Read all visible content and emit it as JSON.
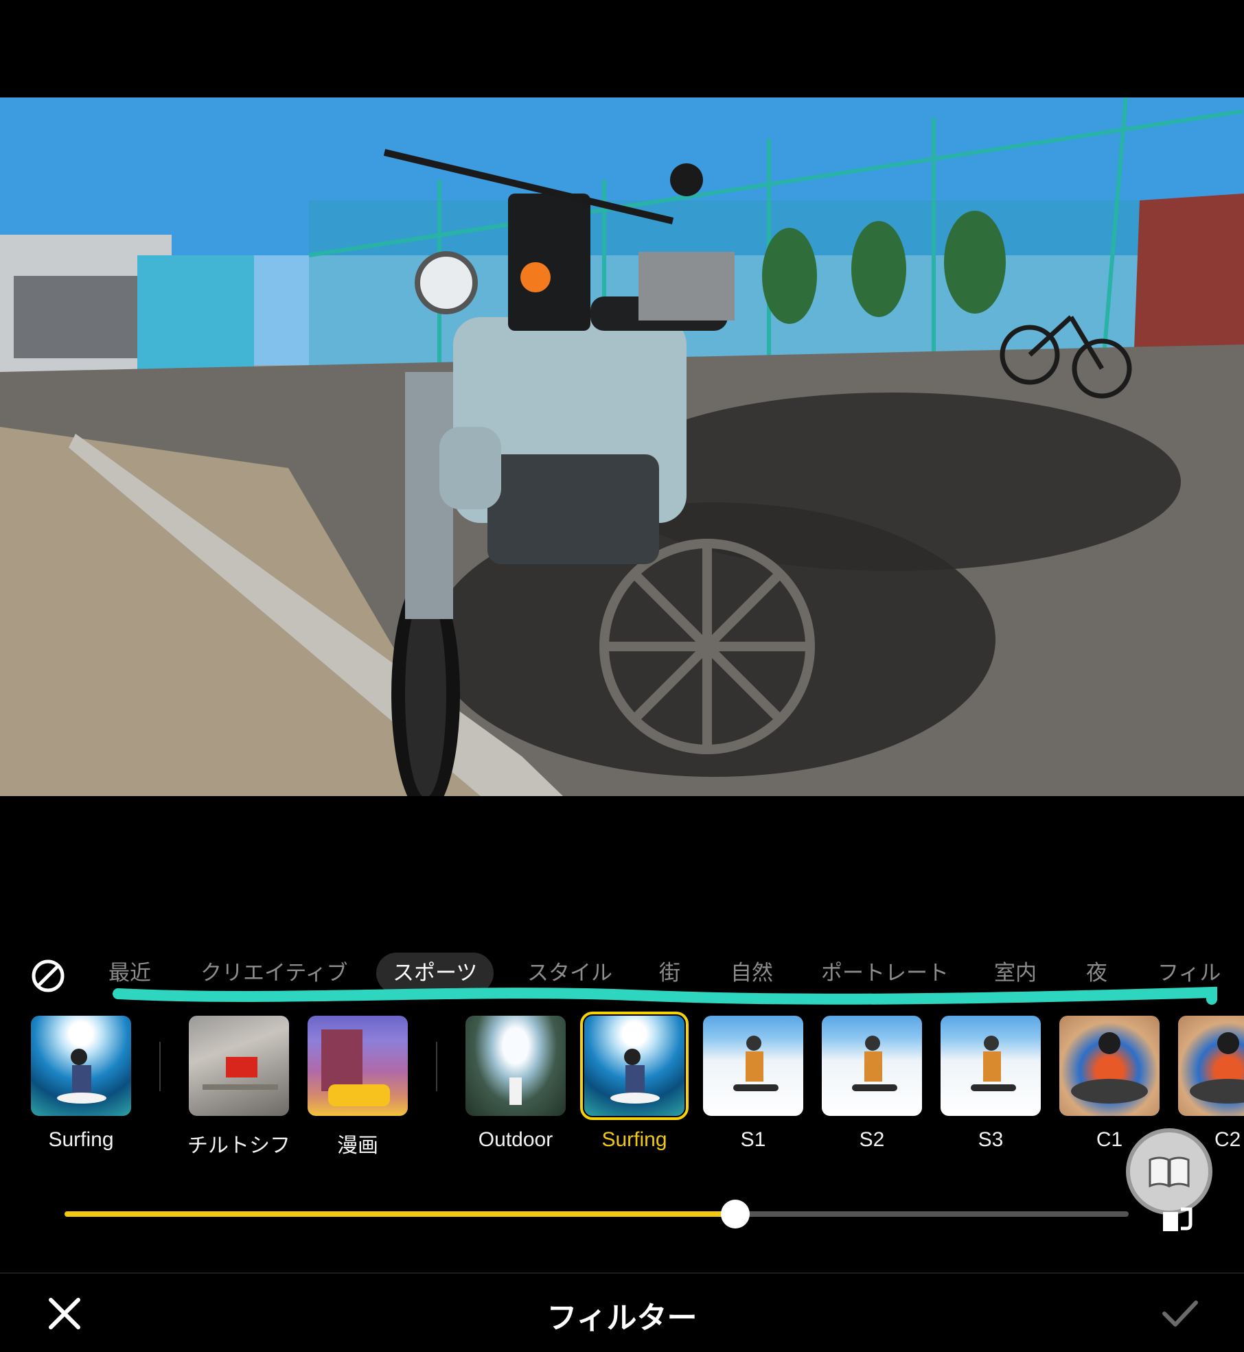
{
  "header": {
    "title": "フィルター"
  },
  "tabs": [
    {
      "label": "最近"
    },
    {
      "label": "クリエイティブ"
    },
    {
      "label": "スポーツ",
      "active": true
    },
    {
      "label": "スタイル"
    },
    {
      "label": "街"
    },
    {
      "label": "自然"
    },
    {
      "label": "ポートレート"
    },
    {
      "label": "室内"
    },
    {
      "label": "夜"
    },
    {
      "label": "フィル"
    }
  ],
  "filters": [
    {
      "label": "Surfing",
      "icon": "surfing-thumbnail",
      "group": "recent"
    },
    {
      "label": "チルトシフ",
      "icon": "tilt-shift-thumbnail",
      "group": "creative"
    },
    {
      "label": "漫画",
      "icon": "manga-thumbnail",
      "group": "creative"
    },
    {
      "label": "Outdoor",
      "icon": "outdoor-thumbnail",
      "group": "sports"
    },
    {
      "label": "Surfing",
      "icon": "surfing-thumbnail",
      "group": "sports",
      "selected": true
    },
    {
      "label": "S1",
      "icon": "snowboard-thumbnail",
      "group": "sports"
    },
    {
      "label": "S2",
      "icon": "snowboard-thumbnail",
      "group": "sports"
    },
    {
      "label": "S3",
      "icon": "snowboard-thumbnail",
      "group": "sports"
    },
    {
      "label": "C1",
      "icon": "cycling-thumbnail",
      "group": "sports"
    },
    {
      "label": "C2",
      "icon": "cycling-thumbnail",
      "group": "sports"
    }
  ],
  "slider": {
    "value": 0.63
  },
  "colors": {
    "accent": "#f2c811",
    "annotation": "#2fd6bf",
    "background": "#000000"
  },
  "icons": {
    "no_filter": "no-filter-icon",
    "close": "close-icon",
    "confirm": "checkmark-icon",
    "guide": "book-icon",
    "external": "external-link-icon"
  }
}
